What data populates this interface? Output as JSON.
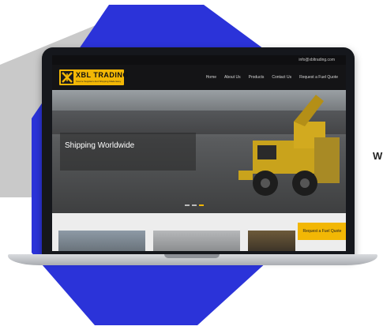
{
  "topbar": {
    "email": "info@xbltrading.com"
  },
  "logo": {
    "brand": "XBL TRADING",
    "tagline": "Source Suppliers And Shipping Made Easy"
  },
  "nav": {
    "items": [
      "Home",
      "About Us",
      "Products",
      "Contact Us",
      "Request a Fuel Quote"
    ]
  },
  "hero": {
    "caption": "Shipping Worldwide",
    "slides": 3,
    "active_slide": 3
  },
  "quote_button": {
    "label": "Request a Fuel Quote"
  },
  "side_text": "W",
  "colors": {
    "accent": "#f2b705",
    "blue": "#2b33d9",
    "gray": "#c8c8c8",
    "dark": "#15171c"
  }
}
